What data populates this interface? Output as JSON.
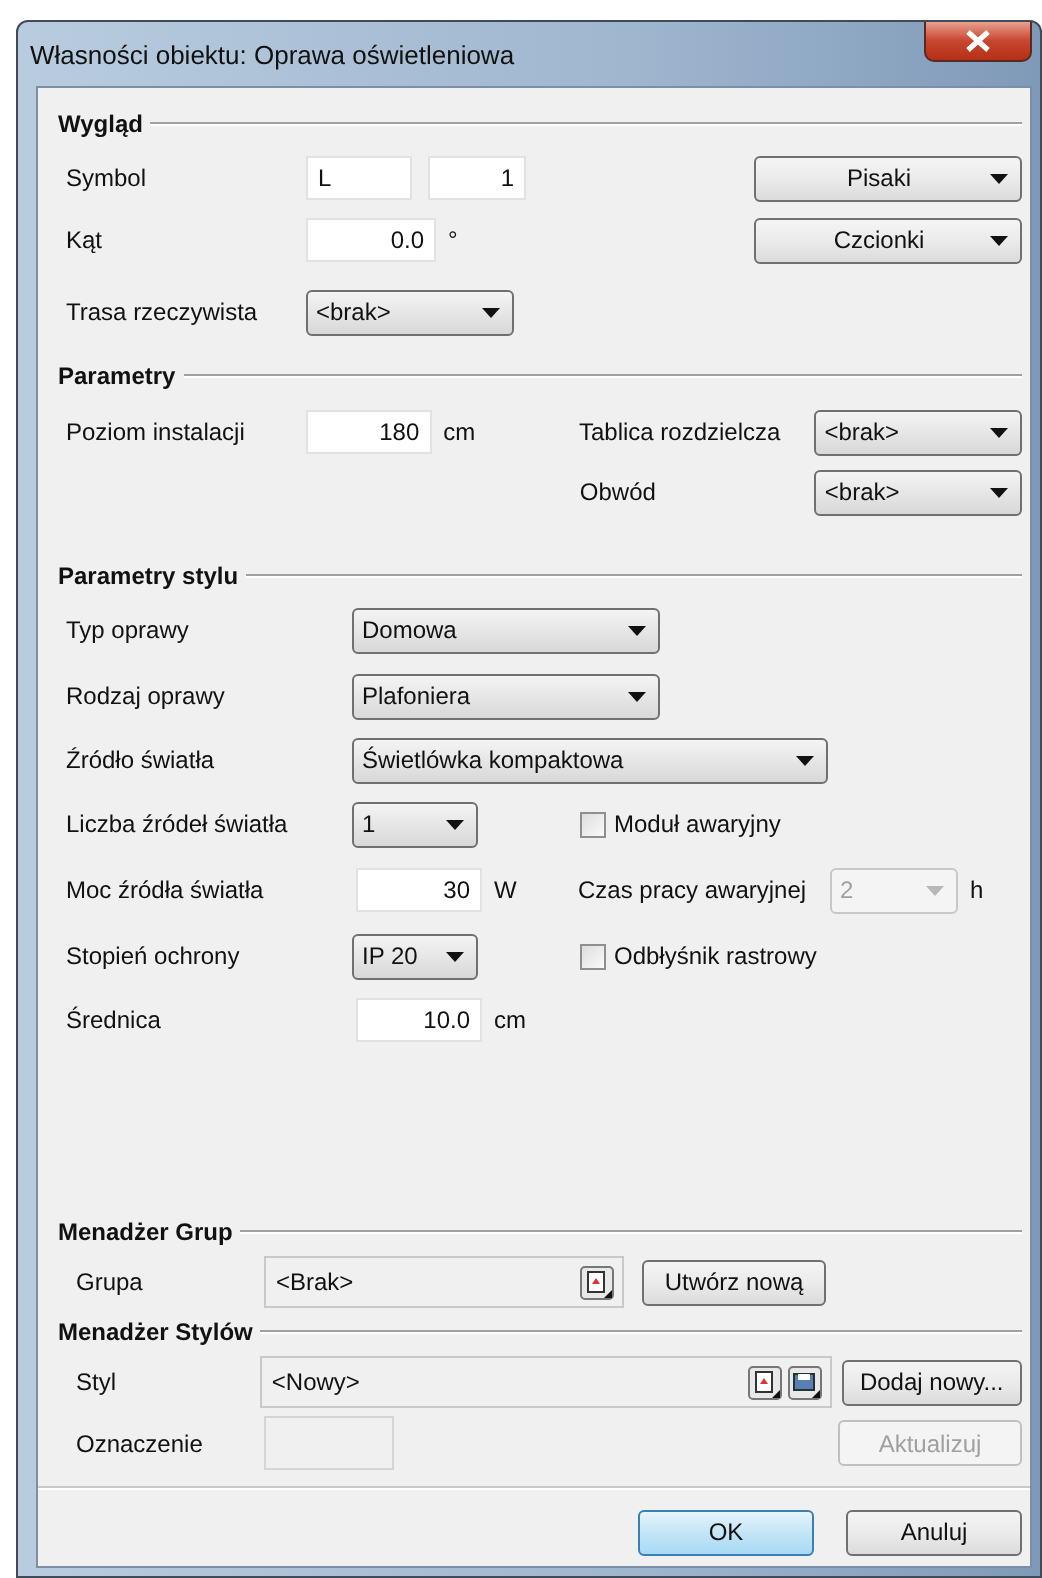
{
  "window": {
    "title": "Własności obiektu: Oprawa oświetleniowa"
  },
  "appearance": {
    "heading": "Wygląd",
    "symbol": {
      "label": "Symbol",
      "value_1": "L",
      "value_2": "1"
    },
    "angle": {
      "label": "Kąt",
      "value": "0.0",
      "unit": "°"
    },
    "route": {
      "label": "Trasa rzeczywista",
      "value": "<brak>"
    },
    "pens_button": "Pisaki",
    "fonts_button": "Czcionki"
  },
  "parameters": {
    "heading": "Parametry",
    "level": {
      "label": "Poziom instalacji",
      "value": "180",
      "unit": "cm"
    },
    "board": {
      "label": "Tablica rozdzielcza",
      "value": "<brak>"
    },
    "circuit": {
      "label": "Obwód",
      "value": "<brak>"
    }
  },
  "style_parameters": {
    "heading": "Parametry stylu",
    "fixture_type": {
      "label": "Typ oprawy",
      "value": "Domowa"
    },
    "fixture_kind": {
      "label": "Rodzaj oprawy",
      "value": "Plafoniera"
    },
    "light_source": {
      "label": "Źródło światła",
      "value": "Świetlówka kompaktowa"
    },
    "source_count": {
      "label": "Liczba źródeł światła",
      "value": "1"
    },
    "emergency_module": {
      "label": "Moduł awaryjny",
      "checked": false
    },
    "power": {
      "label": "Moc źródła światła",
      "value": "30",
      "unit": "W"
    },
    "emergency_time": {
      "label": "Czas pracy awaryjnej",
      "value": "2",
      "unit": "h",
      "disabled": true
    },
    "protection": {
      "label": "Stopień ochrony",
      "value": "IP 20"
    },
    "raster_reflector": {
      "label": "Odbłyśnik rastrowy",
      "checked": false
    },
    "diameter": {
      "label": "Średnica",
      "value": "10.0",
      "unit": "cm"
    }
  },
  "group_manager": {
    "heading": "Menadżer Grup",
    "group": {
      "label": "Grupa",
      "value": "<Brak>"
    },
    "create_button": "Utwórz nową"
  },
  "style_manager": {
    "heading": "Menadżer Stylów",
    "style": {
      "label": "Styl",
      "value": "<Nowy>"
    },
    "add_button": "Dodaj nowy...",
    "marking": {
      "label": "Oznaczenie",
      "disabled": true
    },
    "update_button": {
      "label": "Aktualizuj",
      "disabled": true
    }
  },
  "buttons": [
    {
      "label": "OK",
      "default": true
    },
    {
      "label": "Anuluj",
      "default": false
    }
  ]
}
